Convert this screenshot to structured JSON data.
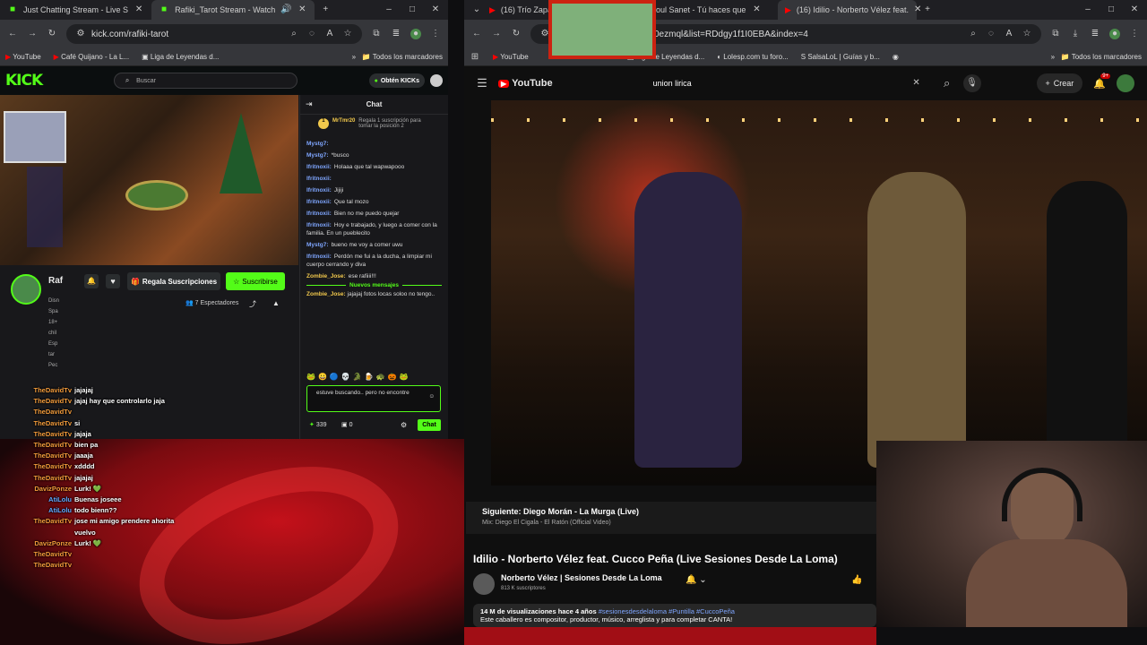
{
  "left_browser": {
    "tabs": [
      {
        "title": "Just Chatting Stream - Live S"
      },
      {
        "title": "Rafiki_Tarot Stream - Watch"
      }
    ],
    "url": "kick.com/rafiki-tarot",
    "bookmarks": [
      "YouTube",
      "Café Quijano - La L...",
      "Liga de Leyendas d...",
      "Todos los marcadores"
    ],
    "kick": {
      "logo": "KICK",
      "search_placeholder": "Buscar",
      "get_kicks": "Obtén KICKs",
      "channel_short": "Raf",
      "gift_subs_button": "Regala Suscripciones",
      "subscribe_button": "Suscribirse",
      "viewers": "7 Espectadores",
      "chat_title": "Chat",
      "pinned_user": "MrTmr20",
      "pinned_text": "Regala 1 suscripción para tomar la posición 2",
      "new_messages": "Nuevos mensajes",
      "chat_input_value": "estuve buscando.. pero no encontre",
      "points": "339",
      "count2": "0",
      "chat_button": "Chat",
      "messages": [
        {
          "user": "Mystg7:",
          "text": "",
          "cls": "u-blue"
        },
        {
          "user": "Mystg7:",
          "text": "*busco",
          "cls": "u-blue"
        },
        {
          "user": "lfritnoxii:",
          "text": "Holaaa que tal wapwapooo",
          "cls": "u-blue"
        },
        {
          "user": "lfritnoxii:",
          "text": "",
          "cls": "u-blue"
        },
        {
          "user": "lfritnoxii:",
          "text": "Jijiji",
          "cls": "u-blue"
        },
        {
          "user": "lfritnoxii:",
          "text": "Que tal mozo",
          "cls": "u-blue"
        },
        {
          "user": "lfritnoxii:",
          "text": "Bien no me puedo quejar",
          "cls": "u-blue"
        },
        {
          "user": "lfritnoxii:",
          "text": "Hoy e trabajado, y luego a comer con la familia. En un pueblecito",
          "cls": "u-blue"
        },
        {
          "user": "Mystg7:",
          "text": "bueno me voy a comer uwu",
          "cls": "u-blue"
        },
        {
          "user": "lfritnoxii:",
          "text": "Perdón me fui a la ducha, a limpiar mi cuerpo cerrando y diva",
          "cls": "u-blue"
        },
        {
          "user": "Zombie_Jose:",
          "text": "ese rafiiii!!!",
          "cls": "u-yel"
        }
      ],
      "after_new": {
        "user": "Zombie_Jose:",
        "text": "jajajaj fotos locas soloo no tengo.."
      },
      "side_tags": [
        "Disn",
        "Spa",
        "18+",
        "chil",
        "Esp",
        "tar",
        "Pec"
      ]
    }
  },
  "overlay_chat": [
    {
      "user": "TheDavidTv",
      "msg": "jajajaj",
      "cls": "g"
    },
    {
      "user": "TheDavidTv",
      "msg": "jajaj hay que controlarlo jaja",
      "cls": "g"
    },
    {
      "user": "TheDavidTv",
      "msg": "",
      "cls": "g"
    },
    {
      "user": "TheDavidTv",
      "msg": "si",
      "cls": "g"
    },
    {
      "user": "TheDavidTv",
      "msg": "jajaja",
      "cls": "g"
    },
    {
      "user": "TheDavidTv",
      "msg": "bien pa",
      "cls": "g"
    },
    {
      "user": "TheDavidTv",
      "msg": "jaaaja",
      "cls": "g"
    },
    {
      "user": "TheDavidTv",
      "msg": "xdddd",
      "cls": "g"
    },
    {
      "user": "TheDavidTv",
      "msg": "jajajaj",
      "cls": "g"
    },
    {
      "user": "DavizPonze",
      "msg": "Lurk! 💚",
      "cls": "g"
    },
    {
      "user": "AtiLolu",
      "msg": "Buenas joseee",
      "cls": "b"
    },
    {
      "user": "AtiLolu",
      "msg": "todo bienn??",
      "cls": "b"
    },
    {
      "user": "TheDavidTv",
      "msg": "jose mi amigo prendere ahorita",
      "cls": "g"
    },
    {
      "user": "",
      "msg": "vuelvo",
      "cls": "g"
    },
    {
      "user": "DavizPonze",
      "msg": "Lurk! 💚",
      "cls": "g"
    },
    {
      "user": "TheDavidTv",
      "msg": "",
      "cls": "g"
    },
    {
      "user": "TheDavidTv",
      "msg": "",
      "cls": "g"
    }
  ],
  "right_browser": {
    "tabs": [
      {
        "title": "(16) Trío Zapa"
      },
      {
        "title": "Soul Sanet - Tú haces que"
      },
      {
        "title": "(16) Idilio - Norberto Vélez feat."
      }
    ],
    "url": "zy0ezmql&list=RDdgy1f1I0EBA&index=4",
    "bookmarks": [
      "YouTube",
      "La L...",
      "Liga de Leyendas d...",
      "Lolesp.com tu foro...",
      "SalsaLoL | Guías y b...",
      "Todos los marcadores"
    ],
    "youtube": {
      "logo": "YouTube",
      "search_value": "union lirica",
      "create_label": "Crear",
      "notif_count": "9+",
      "next_label": "Siguiente: Diego Morán - La Murga (Live)",
      "next_sub": "Mix: Diego El Cigala - El Ratón (Official Video)",
      "video_title": "Idilio - Norberto Vélez feat. Cucco Peña (Live Sesiones Desde La Loma)",
      "channel": "Norberto Vélez | Sesiones Desde La Loma",
      "subscribers": "813 K suscriptores",
      "views_line": "14 M de visualizaciones  hace 4 años",
      "hashtags": "#sesionesdesdelaloma #Puntilla #CuccoPeña",
      "desc": "Este caballero es compositor, productor, músico, arreglista y para completar CANTA!"
    }
  },
  "colors": {
    "kick_green": "#53fc18",
    "yt_red": "#ff0000",
    "overlay_red": "#c4111a"
  }
}
